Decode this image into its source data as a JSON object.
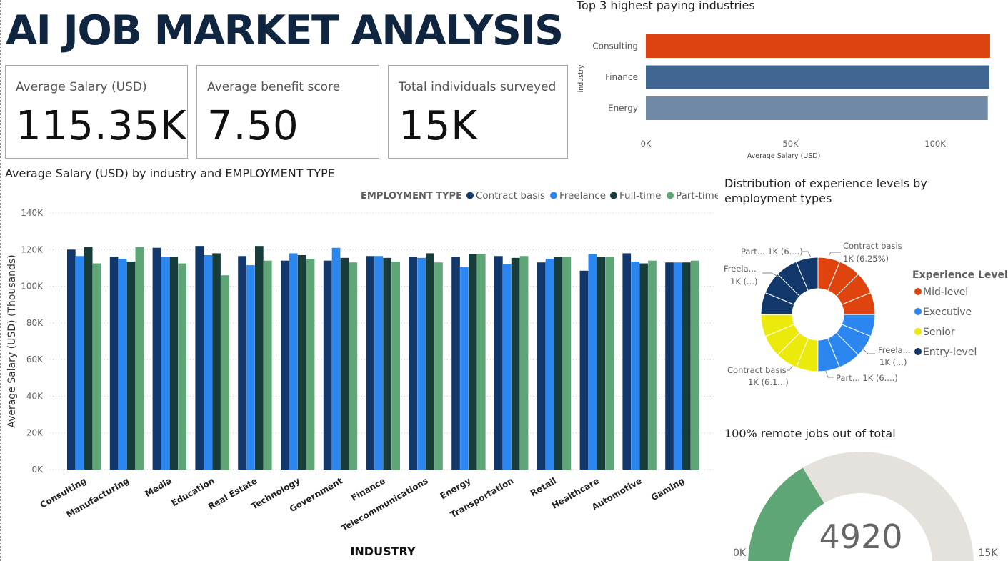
{
  "header": {
    "title": "AI JOB MARKET ANALYSIS"
  },
  "kpis": [
    {
      "label": "Average Salary (USD)",
      "value": "115.35K"
    },
    {
      "label": "Average benefit score",
      "value": "7.50"
    },
    {
      "label": "Total individuals surveyed",
      "value": "15K"
    }
  ],
  "colors": {
    "contract": "#12386b",
    "freelance": "#2c86f0",
    "fulltime": "#173d3a",
    "parttime": "#5ea676",
    "consulting_bar": "#dd4310",
    "finance_bar": "#3f6590",
    "energy_bar": "#7089a6",
    "mid": "#e0440e",
    "exec": "#2c86f0",
    "senior": "#ecea0a",
    "entry": "#12386b",
    "gauge_fill": "#5ea676",
    "gauge_bg": "#e5e1dc"
  },
  "chart_data": [
    {
      "id": "top3",
      "type": "bar",
      "orientation": "horizontal",
      "title": "Top 3 highest paying industries",
      "xlabel": "Average Salary (USD)",
      "ylabel": "industry",
      "categories": [
        "Consulting",
        "Finance",
        "Energy"
      ],
      "values": [
        119000,
        118700,
        118200
      ],
      "xlim": [
        0,
        120000
      ],
      "xticks": [
        "0K",
        "50K",
        "100K"
      ],
      "xtick_values": [
        0,
        50000,
        100000
      ]
    },
    {
      "id": "salary_by_industry",
      "type": "bar",
      "title": "Average Salary (USD) by industry and EMPLOYMENT TYPE",
      "legend_title": "EMPLOYMENT TYPE",
      "xlabel": "INDUSTRY",
      "ylabel": "Average Salary (USD) (Thousands)",
      "ylim": [
        0,
        140000
      ],
      "yticks": [
        "0K",
        "20K",
        "40K",
        "60K",
        "80K",
        "100K",
        "120K",
        "140K"
      ],
      "ytick_values": [
        0,
        20000,
        40000,
        60000,
        80000,
        100000,
        120000,
        140000
      ],
      "categories": [
        "Consulting",
        "Manufacturing",
        "Media",
        "Education",
        "Real Estate",
        "Technology",
        "Government",
        "Finance",
        "Telecommunications",
        "Energy",
        "Transportation",
        "Retail",
        "Healthcare",
        "Automotive",
        "Gaming"
      ],
      "series": [
        {
          "name": "Contract basis",
          "values": [
            120000,
            116000,
            121000,
            122000,
            116500,
            114000,
            114000,
            116500,
            116000,
            116000,
            116500,
            113000,
            108500,
            118000,
            113000
          ]
        },
        {
          "name": "Freelance",
          "values": [
            116500,
            115000,
            116000,
            117000,
            111500,
            118000,
            121000,
            116500,
            115500,
            110500,
            112000,
            115000,
            117500,
            113500,
            113000
          ]
        },
        {
          "name": "Full-time",
          "values": [
            121500,
            113500,
            116000,
            118000,
            122000,
            117000,
            115500,
            115500,
            118000,
            117500,
            115500,
            116000,
            116000,
            112500,
            113000
          ]
        },
        {
          "name": "Part-time",
          "values": [
            112500,
            121500,
            112500,
            106000,
            114000,
            115000,
            113000,
            113500,
            113000,
            117500,
            116500,
            116000,
            116000,
            114000,
            114000
          ]
        }
      ]
    },
    {
      "id": "experience_donut",
      "type": "pie",
      "donut": true,
      "title": "Distribution of experience levels by employment types",
      "legend_title": "Experience Level",
      "legend": [
        "Mid-level",
        "Executive",
        "Senior",
        "Entry-level"
      ],
      "slices": [
        {
          "level": "Mid-level",
          "label": "Contract basis",
          "value": 938,
          "percent": 6.25
        },
        {
          "level": "Mid-level",
          "label": "Freelance",
          "value": 938,
          "percent": 6.25
        },
        {
          "level": "Mid-level",
          "label": "Full-time",
          "value": 938,
          "percent": 6.25
        },
        {
          "level": "Mid-level",
          "label": "Part-time",
          "value": 938,
          "percent": 6.25
        },
        {
          "level": "Executive",
          "label": "Freelance",
          "value": 938,
          "percent": 6.25
        },
        {
          "level": "Executive",
          "label": "Full-time",
          "value": 938,
          "percent": 6.25
        },
        {
          "level": "Executive",
          "label": "Part-time",
          "value": 938,
          "percent": 6.25
        },
        {
          "level": "Executive",
          "label": "Contract basis",
          "value": 938,
          "percent": 6.25
        },
        {
          "level": "Senior",
          "label": "Contract basis",
          "value": 920,
          "percent": 6.13
        },
        {
          "level": "Senior",
          "label": "Freelance",
          "value": 938,
          "percent": 6.25
        },
        {
          "level": "Senior",
          "label": "Full-time",
          "value": 938,
          "percent": 6.25
        },
        {
          "level": "Senior",
          "label": "Part-time",
          "value": 938,
          "percent": 6.25
        },
        {
          "level": "Entry-level",
          "label": "Full-time",
          "value": 938,
          "percent": 6.25
        },
        {
          "level": "Entry-level",
          "label": "Contract basis",
          "value": 938,
          "percent": 6.25
        },
        {
          "level": "Entry-level",
          "label": "Freelance",
          "value": 938,
          "percent": 6.25
        },
        {
          "level": "Entry-level",
          "label": "Part-time",
          "value": 938,
          "percent": 6.25
        }
      ],
      "callouts": [
        {
          "line1": "Contract basis",
          "line2": "1K (6.25%)"
        },
        {
          "line1": "Freela...",
          "line2": "1K (...)"
        },
        {
          "line1": "Part... 1K (6....)",
          "line2": ""
        },
        {
          "line1": "Contract basis",
          "line2": "1K (6.1...)"
        },
        {
          "line1": "Freela...",
          "line2": "1K (...)"
        },
        {
          "line1": "Part... 1K (6....)",
          "line2": ""
        }
      ]
    },
    {
      "id": "remote_gauge",
      "type": "gauge",
      "title": "100% remote jobs out of total",
      "value": 4920,
      "value_label": "4920",
      "min": 0,
      "max": 15000,
      "min_label": "0K",
      "max_label": "15K"
    }
  ]
}
